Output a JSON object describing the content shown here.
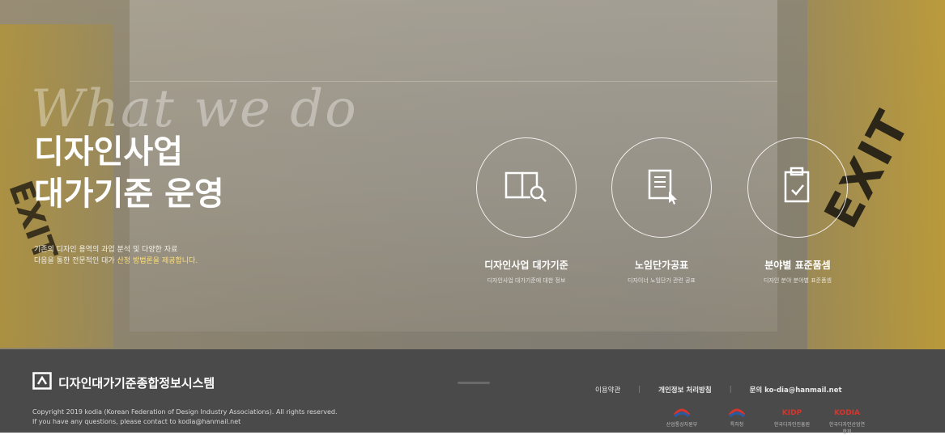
{
  "hero": {
    "script_text": "What we do",
    "title_line1": "디자인사업",
    "title_line2": "대가기준 운영",
    "desc_line1": "기존의 디자인 용역의 과업 분석 및 다양한 자료",
    "desc_line2_prefix": "다음을 통한 전문적인 대가 ",
    "desc_line2_highlight": "산정 방법론을 제공합니다."
  },
  "services": [
    {
      "label": "디자인사업 대가기준",
      "sub": "디자인사업 대가기준에 대한 정보",
      "icon": "book-search-icon"
    },
    {
      "label": "노임단가공표",
      "sub": "디자이너 노임단가 관련 공표",
      "icon": "document-cursor-icon"
    },
    {
      "label": "분야별 표준품셈",
      "sub": "디자인 분야 분야별 표준품셈",
      "icon": "clipboard-check-icon"
    }
  ],
  "footer": {
    "logo_text": "디자인대가기준종합정보시스템",
    "copyright": "Copyright 2019 kodia (Korean Federation of Design Industry Associations). All rights reserved.",
    "contact": "If you have any questions, please contact to kodia@hanmail.net",
    "nav": {
      "terms": "이용약관",
      "privacy": "개인정보 처리방침",
      "inquiry": "문의 ko-dia@hanmail.net"
    },
    "partners": [
      {
        "mark": "",
        "name": "산업통상자원부"
      },
      {
        "mark": "",
        "name": "특허청"
      },
      {
        "mark": "KIDP",
        "name": "한국디자인진흥원"
      },
      {
        "mark": "KODIA",
        "name": "한국디자인산업연합회"
      }
    ]
  },
  "colors": {
    "accent": "#ffe07a",
    "footer_bg": "#4a4a4a",
    "partner_red": "#d9342b",
    "partner_blue": "#2c5aa0"
  }
}
